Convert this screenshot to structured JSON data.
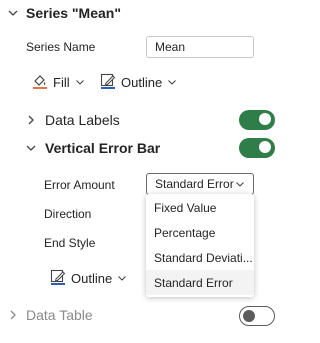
{
  "panel": {
    "title": "Series \"Mean\"",
    "series_name_label": "Series Name",
    "series_name_value": "Mean",
    "fill_label": "Fill",
    "outline_label": "Outline"
  },
  "data_labels": {
    "title": "Data Labels",
    "enabled": true
  },
  "error_bar": {
    "title": "Vertical Error Bar",
    "enabled": true,
    "error_amount_label": "Error Amount",
    "error_amount_value": "Standard Error",
    "direction_label": "Direction",
    "end_style_label": "End Style",
    "outline_label": "Outline",
    "options": [
      "Fixed Value",
      "Percentage",
      "Standard Deviati...",
      "Standard Error"
    ],
    "selected_index": 3
  },
  "data_table": {
    "title": "Data Table",
    "enabled": false
  },
  "colors": {
    "toggle_on": "#2f7d49",
    "fill_accent": "#e8734a",
    "outline_accent": "#2b5fb4"
  }
}
